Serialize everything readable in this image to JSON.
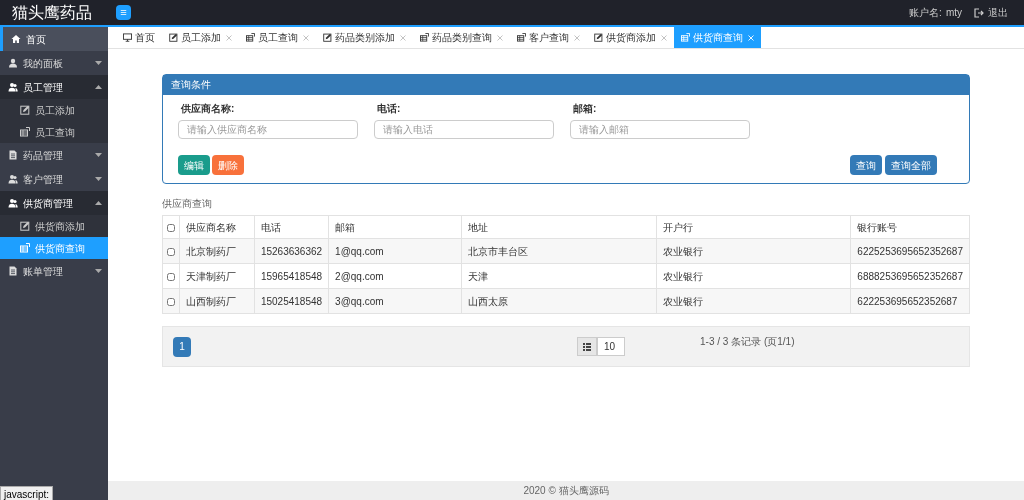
{
  "brand": "猫头鹰药品",
  "header": {
    "menu_toggle": "≡",
    "account_label": "账户名:",
    "account_name": "mty",
    "logout": "退出"
  },
  "sidebar": {
    "items": [
      {
        "label": "首页",
        "kind": "home",
        "selected": true
      },
      {
        "label": "我的面板",
        "kind": "user",
        "expanded": false
      },
      {
        "label": "员工管理",
        "kind": "users",
        "expanded": true,
        "children": [
          {
            "label": "员工添加",
            "kind": "edit",
            "selected": false
          },
          {
            "label": "员工查询",
            "kind": "list",
            "selected": false
          }
        ]
      },
      {
        "label": "药品管理",
        "kind": "file",
        "expanded": false
      },
      {
        "label": "客户管理",
        "kind": "users",
        "expanded": false
      },
      {
        "label": "供货商管理",
        "kind": "users",
        "expanded": true,
        "children": [
          {
            "label": "供货商添加",
            "kind": "edit",
            "selected": false
          },
          {
            "label": "供货商查询",
            "kind": "list",
            "selected": true
          }
        ]
      },
      {
        "label": "账单管理",
        "kind": "file",
        "expanded": false
      }
    ]
  },
  "tabs": [
    {
      "label": "首页",
      "kind": "monitor",
      "closable": false,
      "selected": false
    },
    {
      "label": "员工添加",
      "kind": "edit",
      "closable": true,
      "selected": false
    },
    {
      "label": "员工查询",
      "kind": "list",
      "closable": true,
      "selected": false
    },
    {
      "label": "药品类别添加",
      "kind": "edit",
      "closable": true,
      "selected": false
    },
    {
      "label": "药品类别查询",
      "kind": "list",
      "closable": true,
      "selected": false
    },
    {
      "label": "客户查询",
      "kind": "list",
      "closable": true,
      "selected": false
    },
    {
      "label": "供货商添加",
      "kind": "edit",
      "closable": true,
      "selected": false
    },
    {
      "label": "供货商查询",
      "kind": "list",
      "closable": true,
      "selected": true
    }
  ],
  "search_panel": {
    "title": "查询条件",
    "fields": [
      {
        "label": "供应商名称:",
        "placeholder": "请输入供应商名称"
      },
      {
        "label": "电话:",
        "placeholder": "请输入电话"
      },
      {
        "label": "邮箱:",
        "placeholder": "请输入邮箱"
      }
    ],
    "left_buttons": [
      {
        "label": "编辑",
        "kind": "teal"
      },
      {
        "label": "删除",
        "kind": "orange"
      }
    ],
    "right_buttons": [
      {
        "label": "查询",
        "kind": "blue"
      },
      {
        "label": "查询全部",
        "kind": "blue"
      }
    ]
  },
  "table": {
    "caption": "供应商查询",
    "select_all_checked": false,
    "columns": [
      "供应商名称",
      "电话",
      "邮箱",
      "地址",
      "开户行",
      "银行账号"
    ],
    "rows": [
      {
        "checked": false,
        "cells": [
          "北京制药厂",
          "15263636362",
          "1@qq.com",
          "北京市丰台区",
          "农业银行",
          "6225253695652352687"
        ]
      },
      {
        "checked": false,
        "cells": [
          "天津制药厂",
          "15965418548",
          "2@qq.com",
          "天津",
          "农业银行",
          "6888253695652352687"
        ]
      },
      {
        "checked": false,
        "cells": [
          "山西制药厂",
          "15025418548",
          "3@qq.com",
          "山西太原",
          "农业银行",
          "622253695652352687"
        ]
      }
    ]
  },
  "pagination": {
    "pages": [
      {
        "label": "1",
        "selected": true
      }
    ],
    "page_size": "10",
    "summary": "1-3 / 3 条记录 (页1/1)"
  },
  "footer": "2020 © 猫头鹰源码",
  "status_text": "javascript:"
}
